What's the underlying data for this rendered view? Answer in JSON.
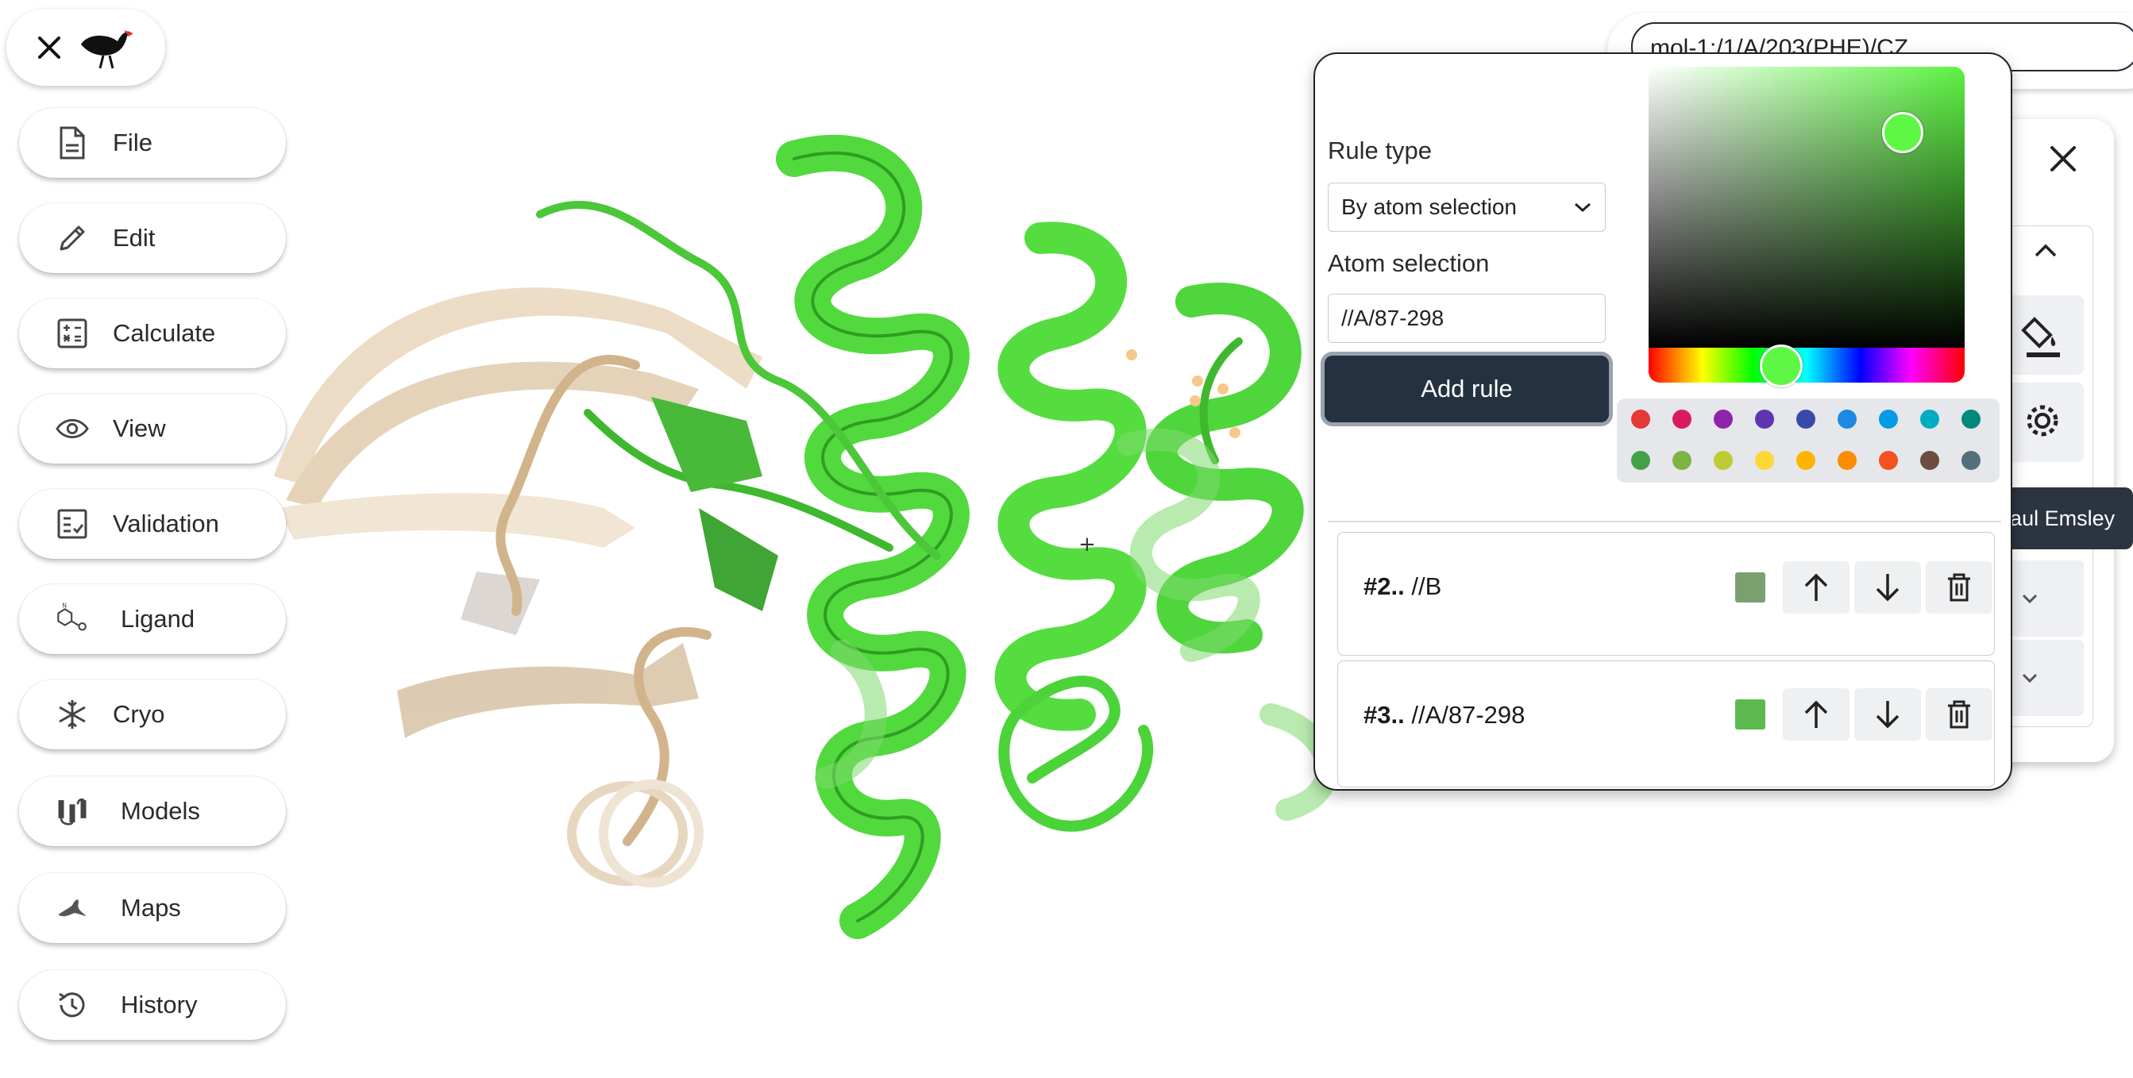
{
  "app": {
    "menu": [
      {
        "label": "File",
        "icon": "file-icon"
      },
      {
        "label": "Edit",
        "icon": "pencil-icon"
      },
      {
        "label": "Calculate",
        "icon": "calculator-icon"
      },
      {
        "label": "View",
        "icon": "eye-icon"
      },
      {
        "label": "Validation",
        "icon": "checklist-icon"
      },
      {
        "label": "Ligand",
        "icon": "ligand-icon"
      },
      {
        "label": "Cryo",
        "icon": "snowflake-icon"
      },
      {
        "label": "Models",
        "icon": "models-icon"
      },
      {
        "label": "Maps",
        "icon": "maps-icon"
      },
      {
        "label": "History",
        "icon": "history-icon"
      }
    ]
  },
  "header": {
    "atom_url": "mol-1:/1/A/203(PHE)/CZ"
  },
  "tooltip": {
    "text": "Talking: Paul Emsley"
  },
  "popup": {
    "rule_type_label": "Rule type",
    "rule_type_value": "By atom selection",
    "atom_selection_label": "Atom selection",
    "atom_selection_value": "//A/87-298",
    "add_rule_label": "Add rule",
    "picker_color": "#5ff745",
    "swatches_row1": [
      "#e53935",
      "#d81b60",
      "#8e24aa",
      "#5e35b1",
      "#3949ab",
      "#1e88e5",
      "#039be5",
      "#00acc1",
      "#00897b"
    ],
    "swatches_row2": [
      "#43a047",
      "#7cb342",
      "#c0ca33",
      "#fdd835",
      "#ffb300",
      "#fb8c00",
      "#f4511e",
      "#6d4c41",
      "#546e7a"
    ],
    "rules": [
      {
        "index": "#2..",
        "selection": "//B",
        "color": "#7aa070"
      },
      {
        "index": "#3..",
        "selection": "//A/87-298",
        "color": "#5bb94f"
      }
    ]
  }
}
